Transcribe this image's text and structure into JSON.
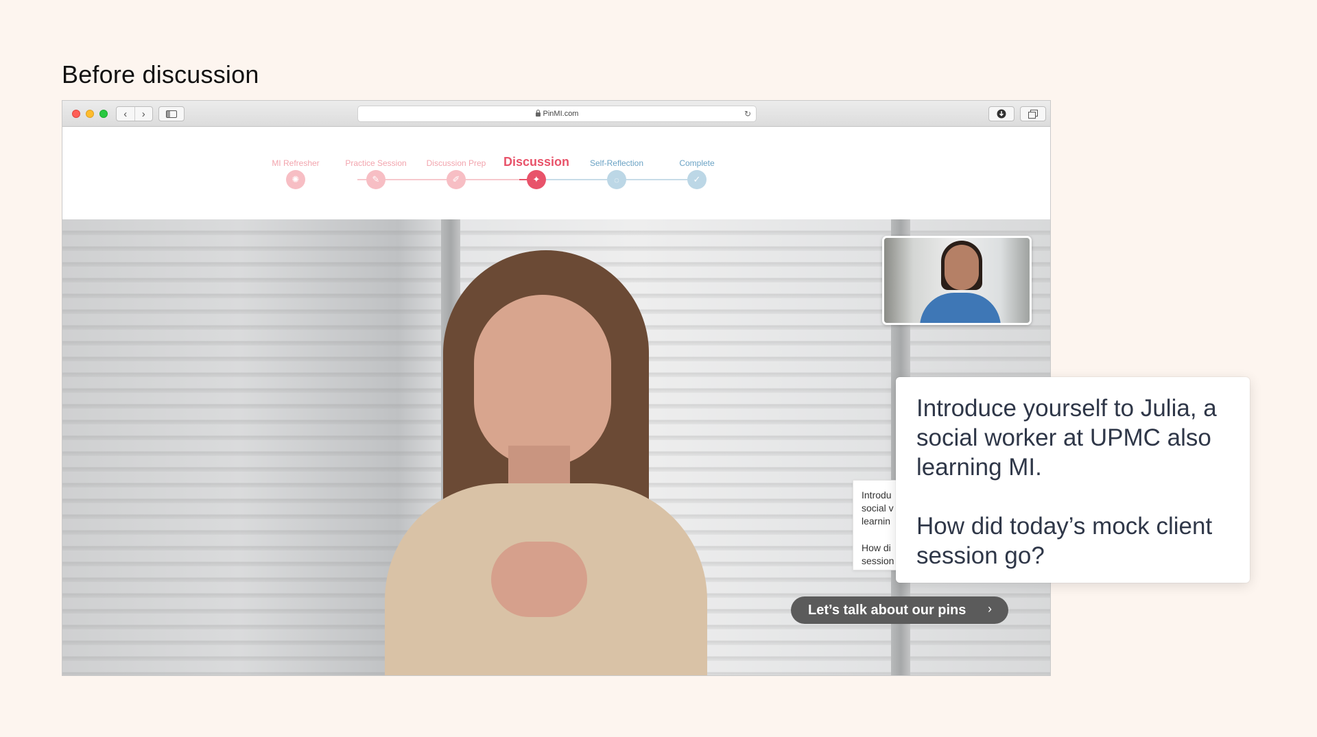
{
  "heading": "Before discussion",
  "browser": {
    "url": "PinMI.com",
    "nav_back": "‹",
    "nav_forward": "›",
    "reload_icon": "↻"
  },
  "steps": [
    {
      "label": "MI Refresher",
      "icon": "brain-icon",
      "state": "done"
    },
    {
      "label": "Practice Session",
      "icon": "pin-icon",
      "state": "done"
    },
    {
      "label": "Discussion Prep",
      "icon": "pencil-icon",
      "state": "done"
    },
    {
      "label": "Discussion",
      "icon": "chat-pin-icon",
      "state": "current"
    },
    {
      "label": "Self-Reflection",
      "icon": "speech-bubble-icon",
      "state": "upcoming"
    },
    {
      "label": "Complete",
      "icon": "check-icon",
      "state": "upcoming"
    }
  ],
  "colors": {
    "done_label": "#f2a4ad",
    "done_circle": "#f7bec4",
    "current": "#e8536a",
    "upcoming_label": "#6aa2c4",
    "upcoming_circle": "#bcd7e6",
    "page_bg": "#fdf5ef",
    "cta_bg": "#5b5b5b"
  },
  "prompt_back": {
    "line1": "Introdu\nsocial v\nlearnin",
    "line2": "How di\nsession"
  },
  "prompt_front": {
    "line1": "Introduce yourself to Julia, a social worker at UPMC also learning MI.",
    "line2": "How did today’s mock client session go?"
  },
  "cta": {
    "label": "Let’s talk about our pins",
    "chevron": "›"
  }
}
